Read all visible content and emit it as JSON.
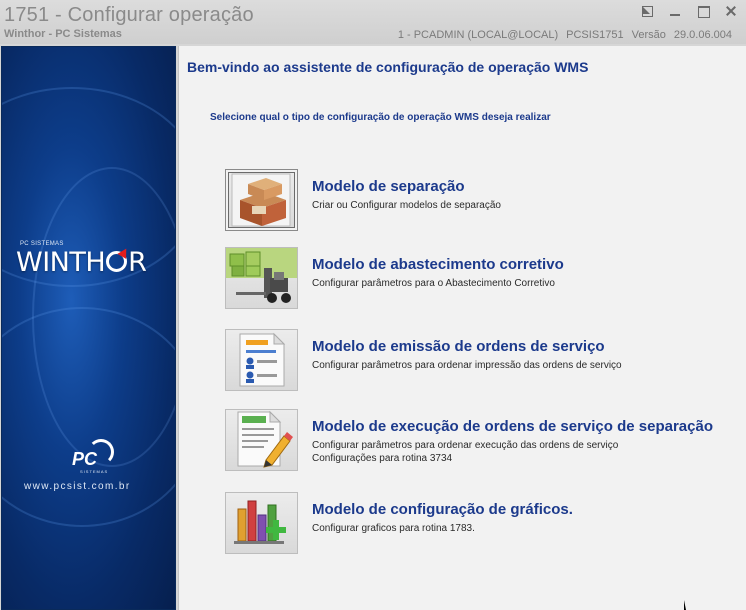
{
  "window": {
    "title": "1751 - Configurar operação",
    "subtitle": "Winthor - PC Sistemas",
    "status": {
      "session": "1 - PCADMIN (LOCAL@LOCAL)",
      "routine": "PCSIS1751",
      "version_label": "Versão",
      "version": "29.0.06.004"
    }
  },
  "sidebar": {
    "brand_small": "PC SISTEMAS",
    "brand_a": "WINTH",
    "brand_b": "R",
    "pc_logo": "PC",
    "pc_logo_sub": "SISTEMAS",
    "website": "www.pcsist.com.br"
  },
  "content": {
    "welcome": "Bem-vindo ao assistente de configuração de operação WMS",
    "prompt": "Selecione qual o tipo de configuração de operação WMS deseja realizar",
    "options": [
      {
        "title": "Modelo de separação",
        "desc": [
          "Criar ou Configurar modelos de separação"
        ],
        "icon": "boxes-icon",
        "selected": true
      },
      {
        "title": "Modelo de abastecimento corretivo",
        "desc": [
          "Configurar parâmetros para o Abastecimento Corretivo"
        ],
        "icon": "forklift-icon",
        "selected": false
      },
      {
        "title": "Modelo de emissão de ordens de serviço",
        "desc": [
          "Configurar parâmetros para ordenar impressão das ordens de serviço"
        ],
        "icon": "document-users-icon",
        "selected": false
      },
      {
        "title": "Modelo de execução de ordens de serviço de separação",
        "desc": [
          "Configurar parâmetros para ordenar execução das ordens de serviço",
          "Configurações para rotina 3734"
        ],
        "icon": "document-edit-icon",
        "selected": false
      },
      {
        "title": "Modelo de configuração de gráficos.",
        "desc": [
          "Configurar graficos para rotina 1783."
        ],
        "icon": "chart-add-icon",
        "selected": false
      }
    ]
  }
}
